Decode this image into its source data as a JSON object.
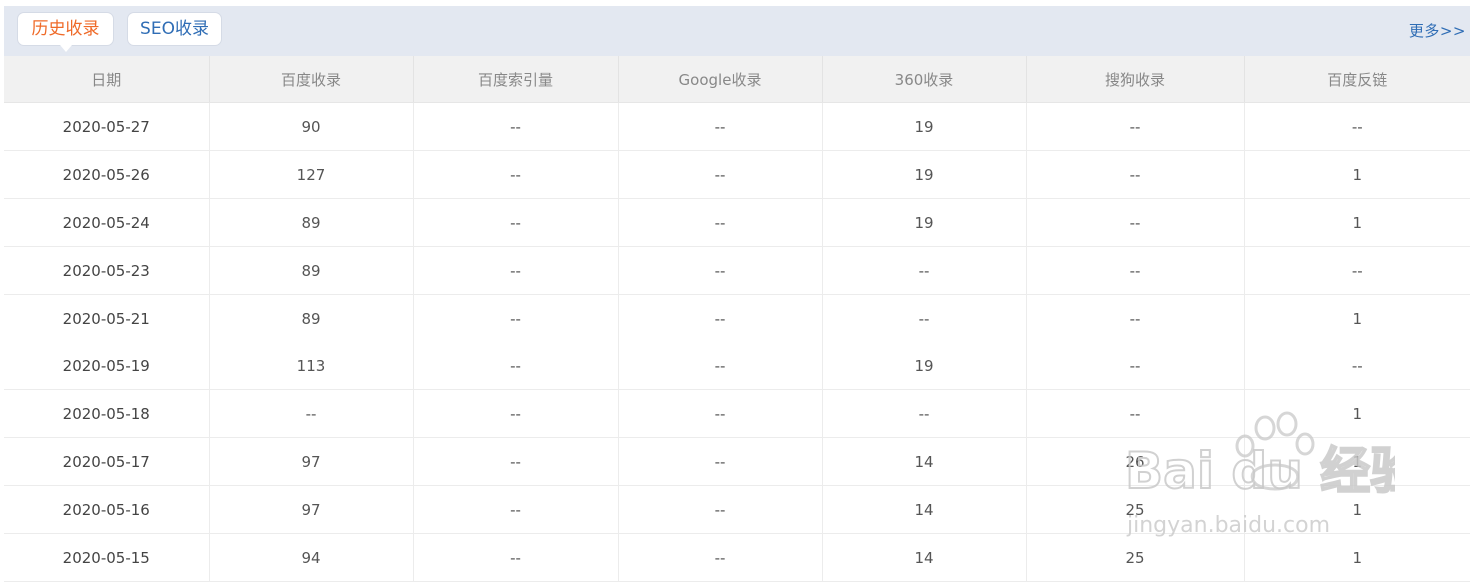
{
  "tabs": [
    {
      "label": "历史收录",
      "active": true
    },
    {
      "label": "SEO收录",
      "active": false
    }
  ],
  "more_label": "更多>>",
  "columns": [
    "日期",
    "百度收录",
    "百度索引量",
    "Google收录",
    "360收录",
    "搜狗收录",
    "百度反链"
  ],
  "rows": [
    [
      "2020-05-27",
      "90",
      "--",
      "--",
      "19",
      "--",
      "--"
    ],
    [
      "2020-05-26",
      "127",
      "--",
      "--",
      "19",
      "--",
      "1"
    ],
    [
      "2020-05-24",
      "89",
      "--",
      "--",
      "19",
      "--",
      "1"
    ],
    [
      "2020-05-23",
      "89",
      "--",
      "--",
      "--",
      "--",
      "--"
    ],
    [
      "2020-05-21",
      "89",
      "--",
      "--",
      "--",
      "--",
      "1"
    ],
    [
      "2020-05-19",
      "113",
      "--",
      "--",
      "19",
      "--",
      "--"
    ],
    [
      "2020-05-18",
      "--",
      "--",
      "--",
      "--",
      "--",
      "1"
    ],
    [
      "2020-05-17",
      "97",
      "--",
      "--",
      "14",
      "26",
      "1"
    ],
    [
      "2020-05-16",
      "97",
      "--",
      "--",
      "14",
      "25",
      "1"
    ],
    [
      "2020-05-15",
      "94",
      "--",
      "--",
      "14",
      "25",
      "1"
    ]
  ],
  "watermark": {
    "logo": "Bai du 经验",
    "url": "jingyan.baidu.com"
  },
  "colors": {
    "active_tab": "#ef6a28",
    "link": "#2f6db5",
    "tabbar_bg": "#e3e8f1",
    "header_bg": "#f1f1f1"
  }
}
